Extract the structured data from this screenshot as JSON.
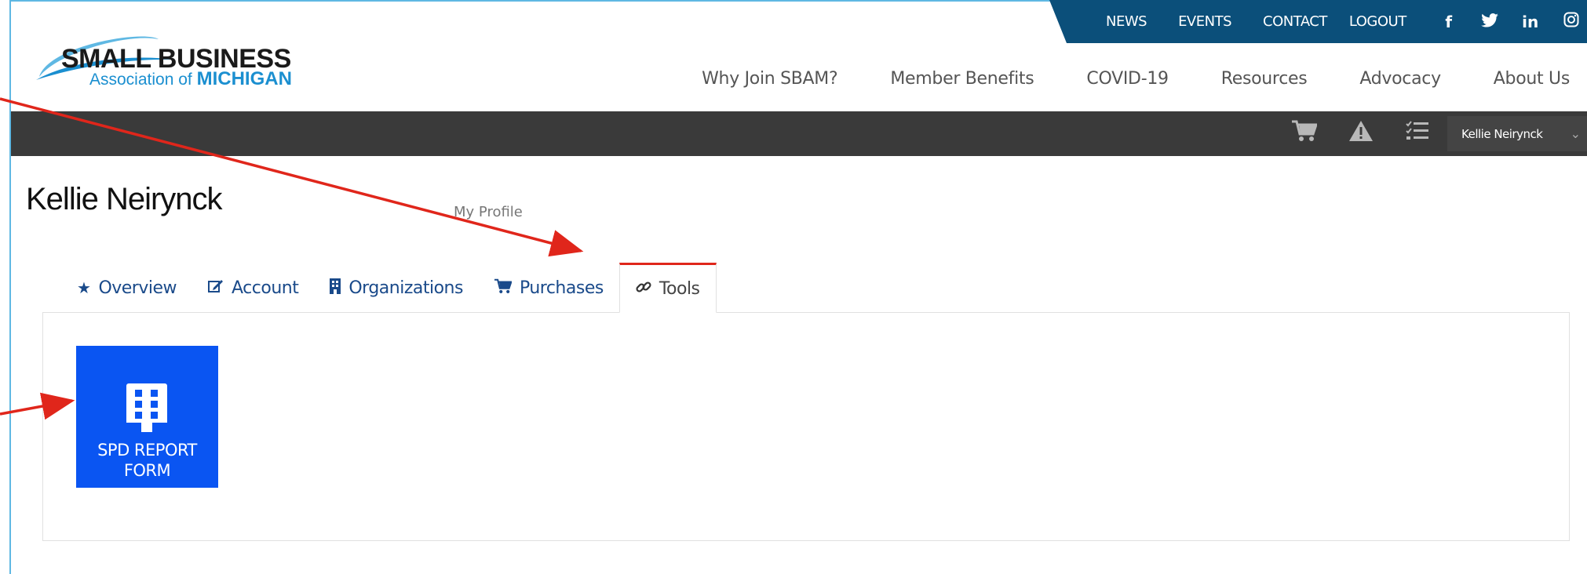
{
  "header": {
    "logo": {
      "line1": "SMALL BUSINESS",
      "line2_prefix": "Association of",
      "line2_bold": "MICHIGAN"
    },
    "utility_links": [
      "NEWS",
      "EVENTS",
      "CONTACT",
      "LOGOUT"
    ],
    "social_icons": [
      "facebook-icon",
      "twitter-icon",
      "linkedin-icon",
      "instagram-icon",
      "youtube-icon"
    ],
    "main_nav": [
      "Why Join SBAM?",
      "Member Benefits",
      "COVID-19",
      "Resources",
      "Advocacy",
      "About Us"
    ]
  },
  "toolbar": {
    "icons": [
      "cart-icon",
      "alert-icon",
      "checklist-icon"
    ],
    "user_name": "Kellie Neirynck"
  },
  "page": {
    "title": "Kellie Neirynck",
    "breadcrumb": "My Profile"
  },
  "tabs": [
    {
      "label": "Overview",
      "icon": "star-icon"
    },
    {
      "label": "Account",
      "icon": "edit-icon"
    },
    {
      "label": "Organizations",
      "icon": "building-icon"
    },
    {
      "label": "Purchases",
      "icon": "cart-icon"
    },
    {
      "label": "Tools",
      "icon": "link-icon",
      "active": true
    }
  ],
  "tools": [
    {
      "label_line1": "SPD REPORT",
      "label_line2": "FORM",
      "icon": "building-icon",
      "color": "#0a55f2"
    }
  ],
  "colors": {
    "brand_blue": "#0b4f7a",
    "tab_text": "#1a4a8a",
    "active_tab_accent": "#e0261b",
    "tile": "#0a55f2",
    "annotation_arrow": "#e0261b"
  }
}
